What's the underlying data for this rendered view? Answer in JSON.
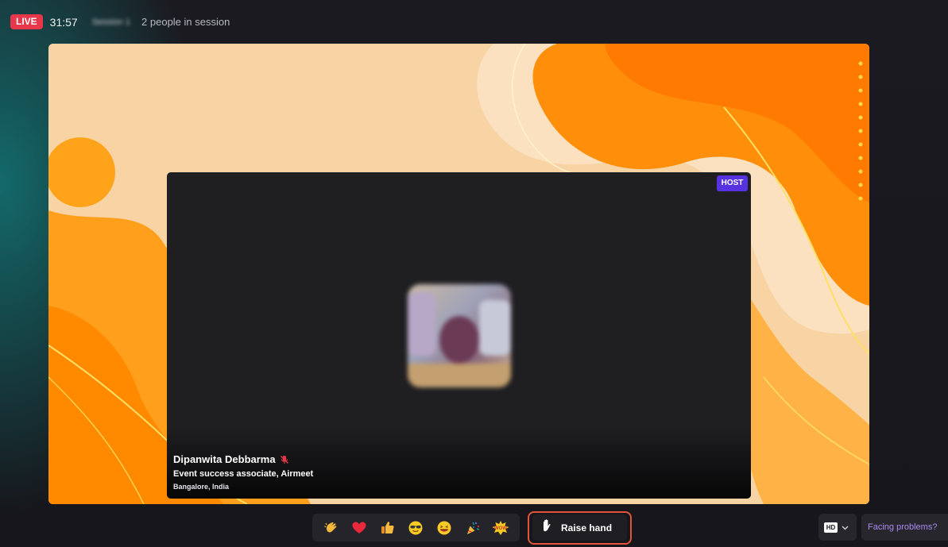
{
  "header": {
    "live_label": "LIVE",
    "timer": "31:57",
    "session_name": "Session 1",
    "people_count_text": "2 people in session"
  },
  "stage": {
    "background_colors": [
      "#f8d3a3",
      "#ff9f1c",
      "#ff8a00",
      "#ffb347"
    ]
  },
  "speaker_tile": {
    "badge": "HOST",
    "name": "Dipanwita Debbarma",
    "role": "Event success associate, Airmeet",
    "location": "Bangalore, India",
    "mic_icon": "mic-off-icon"
  },
  "reactions": [
    {
      "name": "clap-icon"
    },
    {
      "name": "heart-icon"
    },
    {
      "name": "thumbs-up-icon"
    },
    {
      "name": "cool-face-icon"
    },
    {
      "name": "laughing-face-icon"
    },
    {
      "name": "celebrate-icon"
    },
    {
      "name": "wow-icon",
      "text": "WOW"
    }
  ],
  "controls": {
    "raise_hand_label": "Raise hand",
    "quality_label": "HD",
    "help_label": "Facing problems?"
  },
  "colors": {
    "live": "#e8374a",
    "host_badge": "#5632e0",
    "highlight": "#e0543a",
    "link": "#a98cf0"
  }
}
